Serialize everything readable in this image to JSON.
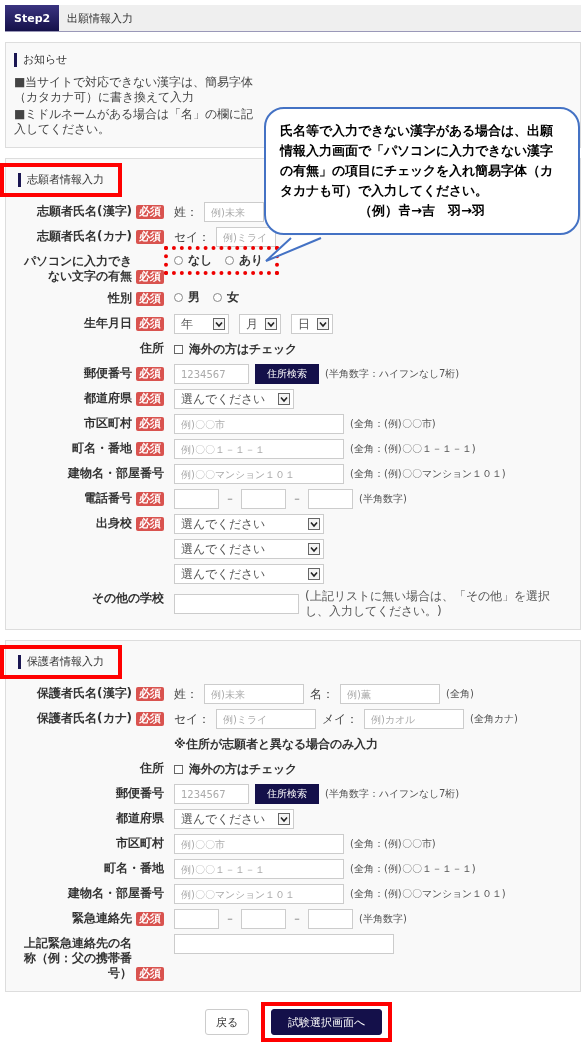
{
  "header": {
    "step": "Step2",
    "title": "出願情報入力"
  },
  "notice": {
    "heading": "お知らせ",
    "lines": [
      "■当サイトで対応できない漢字は、簡易字体（カタカナ可）に書き換えて入力",
      "■ミドルネームがある場合は「名」の欄に記入してください。"
    ]
  },
  "callout": {
    "text": "氏名等で入力できない漢字がある場合は、出願情報入力画面で「パソコンに入力できない漢字の有無」の項目にチェックを入れ簡易字体（カタカナも可）で入力してください。",
    "example": "（例）𠮷→吉　羽→羽"
  },
  "applicant": {
    "heading": "志願者情報入力",
    "highlighted": true,
    "rows": [
      {
        "kind": "name",
        "label": "志願者氏名(漢字)",
        "badge": "必須",
        "parts": [
          {
            "prefix": "姓：",
            "placeholder": "例)未来"
          }
        ]
      },
      {
        "kind": "name",
        "label": "志願者氏名(カナ)",
        "badge": "必須",
        "parts": [
          {
            "prefix": "セイ：",
            "placeholder": "例)ミライ"
          }
        ]
      },
      {
        "kind": "radio",
        "label": "パソコンに入力できない文字の有無",
        "badge": "必須",
        "highlighted": true,
        "options": [
          {
            "label": "なし",
            "selected": false
          },
          {
            "label": "あり",
            "selected": false
          }
        ]
      },
      {
        "kind": "radio",
        "label": "性別",
        "badge": "必須",
        "highlighted": false,
        "options": [
          {
            "label": "男",
            "selected": false
          },
          {
            "label": "女",
            "selected": false
          }
        ]
      },
      {
        "kind": "date",
        "label": "生年月日",
        "badge": "必須",
        "selects": [
          "年",
          "月",
          "日"
        ]
      },
      {
        "kind": "checkbox",
        "label": "住所",
        "option": "海外の方はチェック",
        "checked": false
      },
      {
        "kind": "postal",
        "label": "郵便番号",
        "badge": "必須",
        "placeholder": "1234567",
        "button": "住所検索",
        "hint": "(半角数字：ハイフンなし7桁)"
      },
      {
        "kind": "select",
        "label": "都道府県",
        "badge": "必須",
        "selects": [
          "選んでください"
        ]
      },
      {
        "kind": "text",
        "label": "市区町村",
        "badge": "必須",
        "placeholder": "例)〇〇市",
        "hint": "(全角：(例)〇〇市)"
      },
      {
        "kind": "text",
        "label": "町名・番地",
        "badge": "必須",
        "placeholder": "例)〇〇１－１－１",
        "hint": "(全角：(例)〇〇１－１－１)"
      },
      {
        "kind": "text",
        "label": "建物名・部屋番号",
        "placeholder": "例)〇〇マンション１０１",
        "hint": "(全角：(例)〇〇マンション１０１)"
      },
      {
        "kind": "phone",
        "label": "電話番号",
        "badge": "必須",
        "separators": [
          "－",
          "－"
        ],
        "hint": "(半角数字)"
      },
      {
        "kind": "select_list",
        "label": "出身校",
        "badge": "必須",
        "selects": [
          "選んでください",
          "選んでください",
          "選んでください"
        ]
      },
      {
        "kind": "short_text",
        "label": "その他の学校",
        "hint": "(上記リストに無い場合は、「その他」を選択し、入力してください。)"
      }
    ]
  },
  "guardian": {
    "heading": "保護者情報入力",
    "highlighted": true,
    "rows": [
      {
        "kind": "name",
        "label": "保護者氏名(漢字)",
        "badge": "必須",
        "parts": [
          {
            "prefix": "姓：",
            "placeholder": "例)未来"
          },
          {
            "prefix": "名：",
            "placeholder": "例)薫"
          }
        ],
        "hint": "(全角)"
      },
      {
        "kind": "name",
        "label": "保護者氏名(カナ)",
        "badge": "必須",
        "parts": [
          {
            "prefix": "セイ：",
            "placeholder": "例)ミライ"
          },
          {
            "prefix": "メイ：",
            "placeholder": "例)カオル"
          }
        ],
        "hint": "(全角カナ)"
      },
      {
        "kind": "note",
        "text": "※住所が志願者と異なる場合のみ入力"
      },
      {
        "kind": "checkbox",
        "label": "住所",
        "option": "海外の方はチェック",
        "checked": false
      },
      {
        "kind": "postal",
        "label": "郵便番号",
        "placeholder": "1234567",
        "button": "住所検索",
        "hint": "(半角数字：ハイフンなし7桁)"
      },
      {
        "kind": "select",
        "label": "都道府県",
        "selects": [
          "選んでください"
        ]
      },
      {
        "kind": "text",
        "label": "市区町村",
        "placeholder": "例)〇〇市",
        "hint": "(全角：(例)〇〇市)"
      },
      {
        "kind": "text",
        "label": "町名・番地",
        "placeholder": "例)〇〇１－１－１",
        "hint": "(全角：(例)〇〇１－１－１)"
      },
      {
        "kind": "text",
        "label": "建物名・部屋番号",
        "placeholder": "例)〇〇マンション１０１",
        "hint": "(全角：(例)〇〇マンション１０１)"
      },
      {
        "kind": "phone",
        "label": "緊急連絡先",
        "badge": "必須",
        "separators": [
          "－",
          "－"
        ],
        "hint": "(半角数字)"
      },
      {
        "kind": "long_text",
        "label": "上記緊急連絡先の名称（例：父の携帯番号）",
        "badge": "必須"
      }
    ]
  },
  "buttons": [
    {
      "kind": "secondary",
      "label": "戻る",
      "highlighted": false
    },
    {
      "kind": "primary",
      "label": "試験選択画面へ",
      "highlighted": true
    }
  ]
}
